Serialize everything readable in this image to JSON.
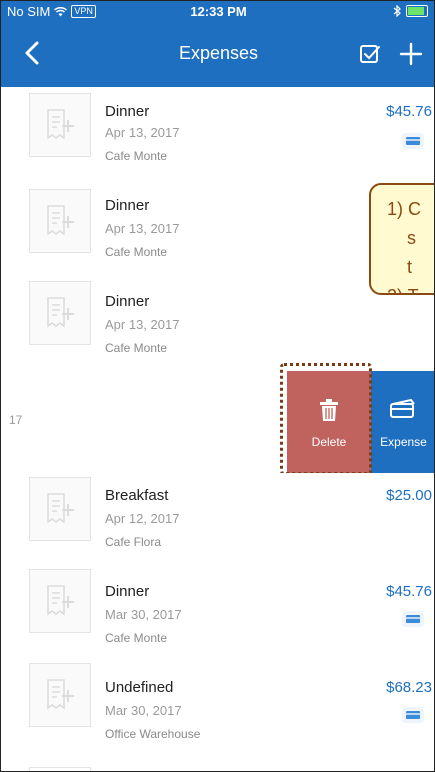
{
  "status": {
    "carrier": "No SIM",
    "vpn": "VPN",
    "time": "12:33 PM"
  },
  "nav": {
    "title": "Expenses"
  },
  "expenses": [
    {
      "title": "Dinner",
      "date": "Apr 13, 2017",
      "merchant": "Cafe Monte",
      "amount": "$45.76",
      "has_card": true
    },
    {
      "title": "Dinner",
      "date": "Apr 13, 2017",
      "merchant": "Cafe Monte",
      "amount": "",
      "has_card": false
    },
    {
      "title": "Dinner",
      "date": "Apr 13, 2017",
      "merchant": "Cafe Monte",
      "amount": "",
      "has_card": false
    },
    {
      "title": "Breakfast",
      "date": "Apr 12, 2017",
      "merchant": "Cafe Flora",
      "amount": "$25.00",
      "has_card": false
    },
    {
      "title": "Dinner",
      "date": "Mar 30, 2017",
      "merchant": "Cafe Monte",
      "amount": "$45.76",
      "has_card": true
    },
    {
      "title": "Undefined",
      "date": "Mar 30, 2017",
      "merchant": "Office Warehouse",
      "amount": "$68.23",
      "has_card": true
    }
  ],
  "swiped_row": {
    "stub_text": "17",
    "delete_label": "Delete",
    "expense_label": "Expense"
  },
  "callout": {
    "line1": "1) C",
    "line2": "s",
    "line3": "t",
    "line4": "2) T"
  },
  "colors": {
    "primary": "#1e6fc0",
    "delete": "#c0625e",
    "annotation": "#8b4a12",
    "callout_bg": "#fffad0"
  },
  "icons": {
    "back": "chevron-left-icon",
    "select": "checkbox-icon",
    "add": "plus-icon",
    "receipt": "receipt-add-icon",
    "trash": "trash-icon",
    "card": "credit-card-icon"
  }
}
